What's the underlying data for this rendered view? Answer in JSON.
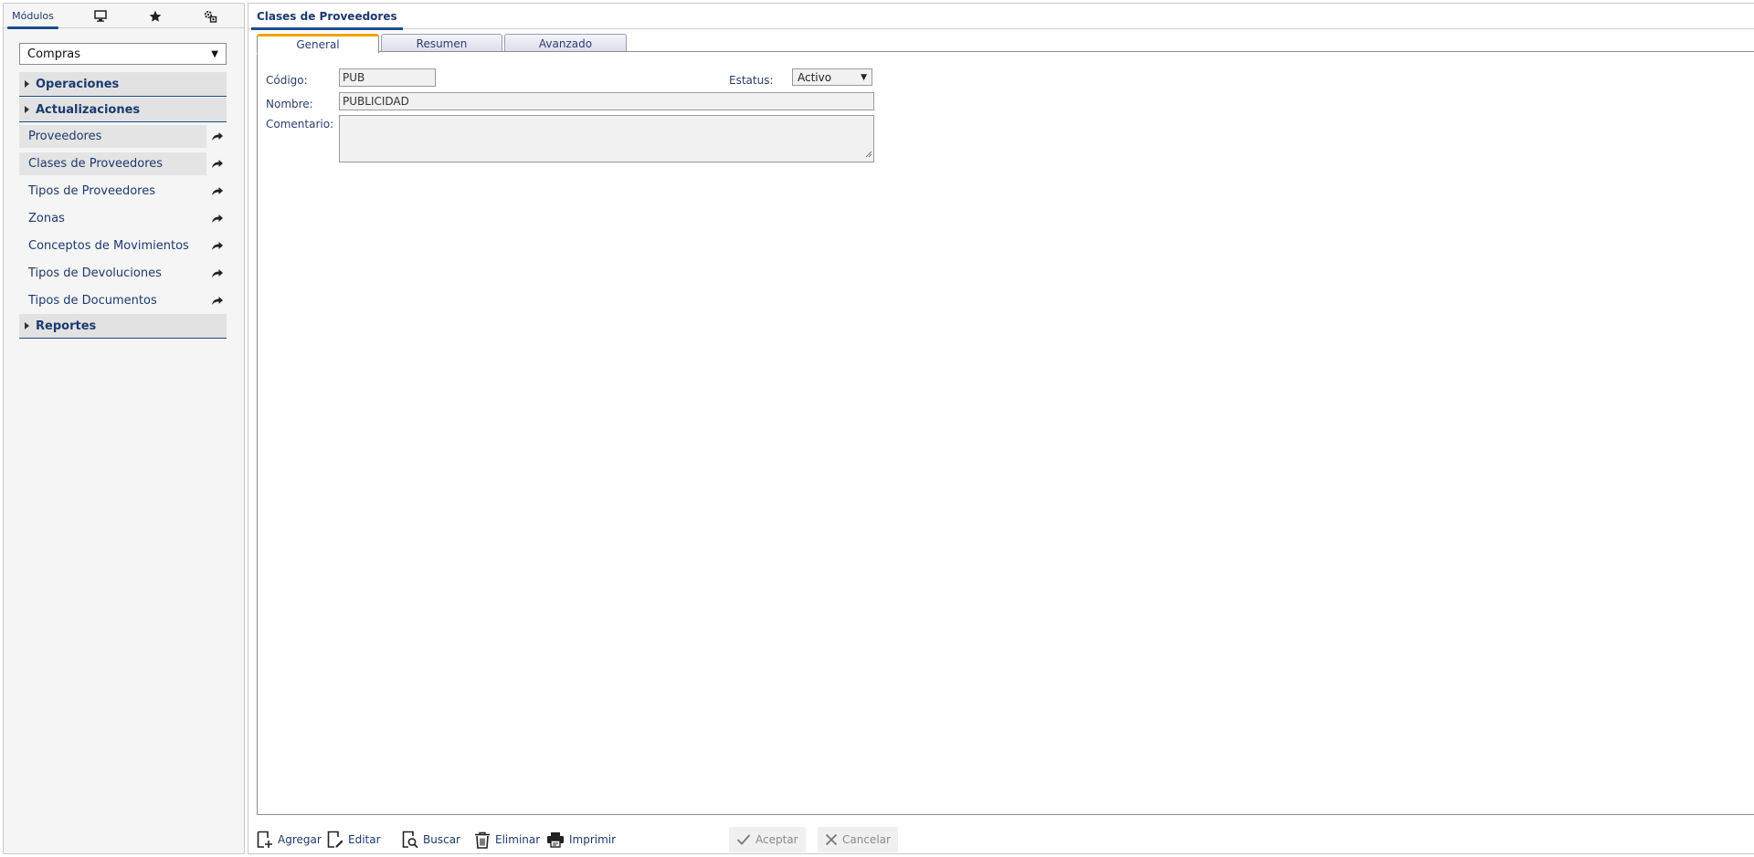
{
  "sidebar": {
    "tabs": [
      {
        "label": "Módulos",
        "icon": "modules"
      },
      {
        "label": "",
        "icon": "monitor-icon"
      },
      {
        "label": "",
        "icon": "star-icon"
      },
      {
        "label": "",
        "icon": "settings-icon"
      }
    ],
    "module_select": {
      "value": "Compras"
    },
    "sections": {
      "operaciones": "Operaciones",
      "actualizaciones": "Actualizaciones",
      "reportes": "Reportes"
    },
    "items": [
      {
        "label": "Proveedores"
      },
      {
        "label": "Clases de Proveedores"
      },
      {
        "label": "Tipos de Proveedores"
      },
      {
        "label": "Zonas"
      },
      {
        "label": "Conceptos de Movimientos"
      },
      {
        "label": "Tipos de Devoluciones"
      },
      {
        "label": "Tipos de Documentos"
      }
    ]
  },
  "main": {
    "title": "Clases de Proveedores",
    "tabs": [
      {
        "label": "General"
      },
      {
        "label": "Resumen"
      },
      {
        "label": "Avanzado"
      }
    ],
    "form": {
      "codigo_label": "Código:",
      "codigo_value": "PUB",
      "estatus_label": "Estatus:",
      "estatus_value": "Activo",
      "nombre_label": "Nombre:",
      "nombre_value": "PUBLICIDAD",
      "comentario_label": "Comentario:",
      "comentario_value": ""
    },
    "toolbar": {
      "agregar": "Agregar",
      "editar": "Editar",
      "buscar": "Buscar",
      "eliminar": "Eliminar",
      "imprimir": "Imprimir",
      "aceptar": "Aceptar",
      "cancelar": "Cancelar"
    }
  },
  "colors": {
    "accent": "#1e4b8f",
    "tab_highlight": "#f0a500",
    "link": "#1c3a6e"
  }
}
